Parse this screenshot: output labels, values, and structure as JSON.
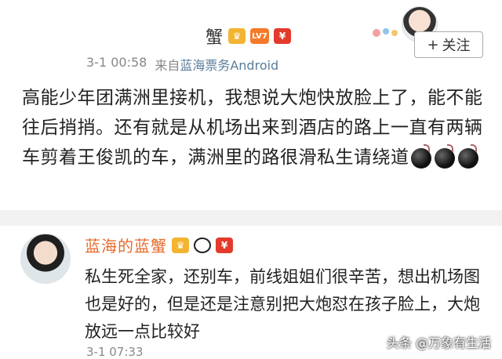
{
  "post": {
    "username": "蟹",
    "badges": {
      "lv": "LV7"
    },
    "time": "3-1 00:58",
    "source_prefix": "来自",
    "source": "蓝海票务Android",
    "body": "高能少年团满洲里接机，我想说大炮快放脸上了，能不能往后捎捎。还有就是从机场出来到酒店的路上一直有两辆车剪着王俊凯的车，满洲里的路很滑私生请绕道",
    "follow_label": "关注"
  },
  "comment": {
    "username": "蓝海的蓝蟹",
    "body": "私生死全家，还别车，前线姐姐们很辛苦，想出机场图也是好的，但是还是注意别把大炮怼在孩子脸上，大炮放远一点比较好",
    "time": "3-1 07:33"
  },
  "watermark": "头条 @万象有生活",
  "colors": {
    "accent": "#e86a2b",
    "link": "#5a7d9a",
    "divider": "#f2f2f2"
  }
}
